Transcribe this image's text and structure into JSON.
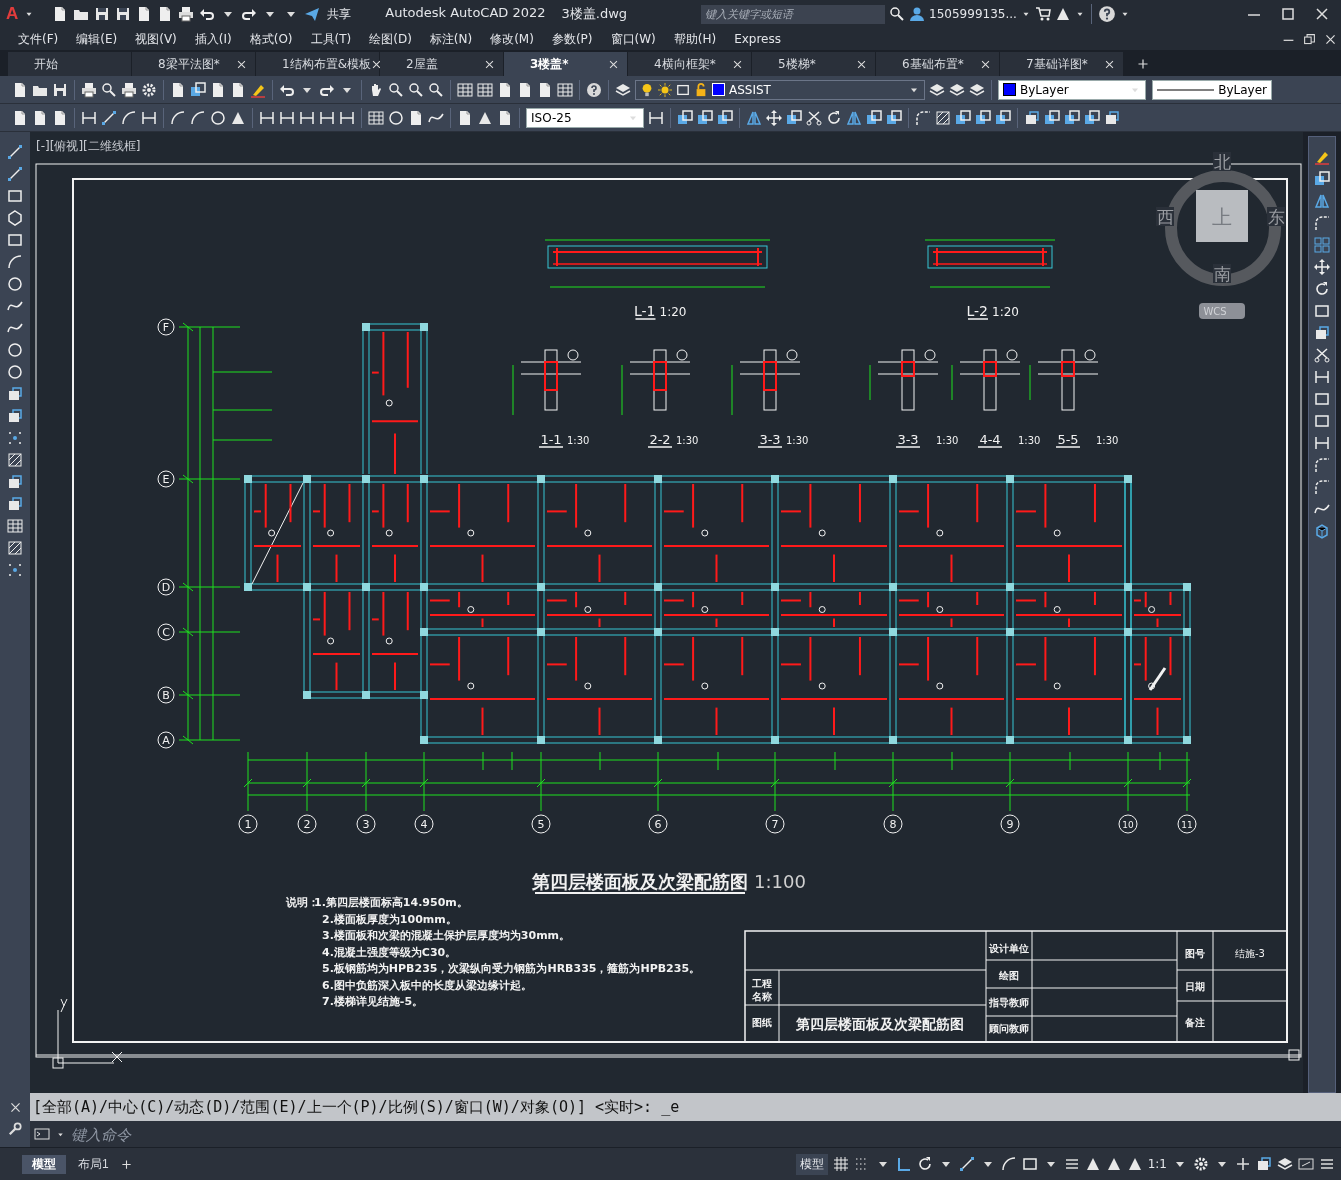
{
  "title_bar": {
    "app_button": "A",
    "share": "共享",
    "title": "Autodesk AutoCAD 2022",
    "file": "3楼盖.dwg",
    "search": {
      "placeholder": "键入关键字或短语"
    },
    "user": "1505999135..."
  },
  "menus": [
    "文件(F)",
    "编辑(E)",
    "视图(V)",
    "插入(I)",
    "格式(O)",
    "工具(T)",
    "绘图(D)",
    "标注(N)",
    "修改(M)",
    "参数(P)",
    "窗口(W)",
    "帮助(H)",
    "Express"
  ],
  "tabs": [
    {
      "label": "开始",
      "selected": false,
      "closable": false
    },
    {
      "label": "8梁平法图*",
      "selected": false,
      "closable": true
    },
    {
      "label": "1结构布置&模板",
      "selected": false,
      "closable": true
    },
    {
      "label": "2屋盖",
      "selected": false,
      "closable": true
    },
    {
      "label": "3楼盖*",
      "selected": true,
      "closable": true
    },
    {
      "label": "4横向框架*",
      "selected": false,
      "closable": true
    },
    {
      "label": "5楼梯*",
      "selected": false,
      "closable": true
    },
    {
      "label": "6基础布置*",
      "selected": false,
      "closable": true
    },
    {
      "label": "7基础详图*",
      "selected": false,
      "closable": true
    }
  ],
  "properties": {
    "layer": "ASSIST",
    "object_color": "ByLayer",
    "linetype": "ByLayer",
    "dim_style": "ISO-25"
  },
  "viewport": {
    "label": "[-][俯视][二维线框]"
  },
  "viewcube": {
    "north": "北",
    "south": "南",
    "east": "东",
    "west": "西",
    "face": "上",
    "ucs": "WCS"
  },
  "drawing": {
    "grid_rows": [
      "F",
      "E",
      "D",
      "C",
      "B",
      "A"
    ],
    "grid_columns": [
      "1",
      "2",
      "3",
      "4",
      "5",
      "6",
      "7",
      "8",
      "9",
      "10",
      "11"
    ],
    "beam_details": [
      {
        "label": "L-1",
        "scale": "1:20"
      },
      {
        "label": "L-2",
        "scale": "1:20"
      }
    ],
    "sections": [
      {
        "label": "1-1",
        "scale": "1:30"
      },
      {
        "label": "2-2",
        "scale": "1:30"
      },
      {
        "label": "3-3",
        "scale": "1:30"
      },
      {
        "label": "3-3",
        "scale": "1:30"
      },
      {
        "label": "4-4",
        "scale": "1:30"
      },
      {
        "label": "5-5",
        "scale": "1:30"
      }
    ],
    "plan_title": "第四层楼面板及次梁配筋图",
    "plan_scale": "1:100",
    "notes_label": "说明：",
    "notes": [
      "1.第四层楼面标高14.950m。",
      "2.楼面板厚度为100mm。",
      "3.楼面板和次梁的混凝土保护层厚度均为30mm。",
      "4.混凝土强度等级为C30。",
      "5.板钢筋均为HPB235，次梁纵向受力钢筋为HRB335，箍筋为HPB235。",
      "6.图中负筋深入板中的长度从梁边缘计起。",
      "7.楼梯详见结施-5。"
    ],
    "title_block": {
      "project_label": "工程名称",
      "sheet_label": "图纸",
      "sheet_title": "第四层楼面板及次梁配筋图",
      "design_unit": "设计单位",
      "drawn": "绘图",
      "advisor": "指导教师",
      "consultant": "顾问教师",
      "drawing_no_label": "图号",
      "drawing_no": "结施-3",
      "date_label": "日期",
      "remarks_label": "备注"
    }
  },
  "command": {
    "history": "[全部(A)/中心(C)/动态(D)/范围(E)/上一个(P)/比例(S)/窗口(W)/对象(O)] <实时>: _e",
    "placeholder": "键入命令"
  },
  "layout_tabs": [
    {
      "label": "模型",
      "selected": true
    },
    {
      "label": "布局1",
      "selected": false
    }
  ],
  "status_bar": {
    "space": "模型",
    "scale": "1:1"
  }
}
